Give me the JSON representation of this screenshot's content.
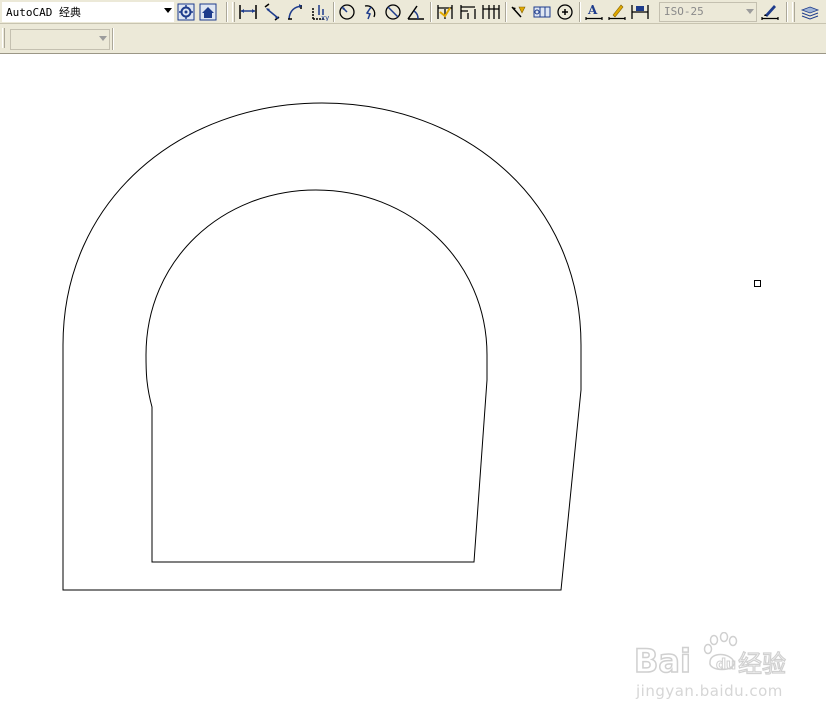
{
  "toolbar": {
    "workspace": {
      "value": "AutoCAD 经典"
    },
    "dimension_style": {
      "value": "ISO-25"
    },
    "secondary_combo": {
      "value": ""
    },
    "icons": [
      "workspace-settings-icon",
      "my-workspace-icon",
      "linear-dimension-icon",
      "aligned-dimension-icon",
      "arc-length-icon",
      "ordinate-dimension-icon",
      "radius-dimension-icon",
      "jogged-dimension-icon",
      "diameter-dimension-icon",
      "angular-dimension-icon",
      "quick-dimension-icon",
      "baseline-dimension-icon",
      "continue-dimension-icon",
      "quick-leader-icon",
      "tolerance-icon",
      "center-mark-icon",
      "dimension-edit-icon",
      "dimension-text-edit-icon",
      "dimension-update-icon",
      "dimension-style-icon",
      "layers-icon"
    ]
  },
  "watermark": {
    "logo_text": "Bai du 经验",
    "url": "jingyan.baidu.com"
  },
  "colors": {
    "toolbar_bg": "#ece9d8",
    "canvas_bg": "#ffffff",
    "drawing_stroke": "#000000",
    "watermark": "#d6d6d6",
    "icon_blue": "#1e3c8c"
  }
}
